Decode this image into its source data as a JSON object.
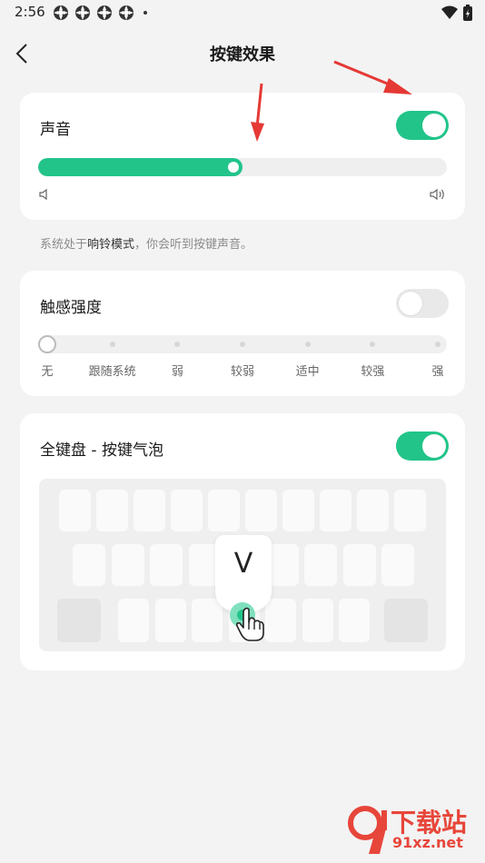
{
  "status": {
    "time": "2:56"
  },
  "header": {
    "title": "按键效果"
  },
  "sound": {
    "label": "声音",
    "enabled": true,
    "volume_percent": 50,
    "hint_prefix": "系统处于",
    "hint_mode": "响铃模式",
    "hint_suffix": "，你会听到按键声音。"
  },
  "haptic": {
    "label": "触感强度",
    "enabled": false,
    "levels": [
      "无",
      "跟随系统",
      "弱",
      "较弱",
      "适中",
      "较强",
      "强"
    ],
    "selected_index": 0
  },
  "keyboard": {
    "label": "全键盘 - 按键气泡",
    "enabled": true,
    "bubble_letter": "V"
  },
  "watermark": {
    "brand": "下载站",
    "domain": "91xz.net"
  },
  "colors": {
    "accent": "#22c48a",
    "background": "#f3f3f3",
    "card": "#ffffff",
    "arrow": "#e53935"
  },
  "icons": {
    "back": "chevron-left-icon",
    "volume_low": "speaker-low-icon",
    "volume_high": "speaker-high-icon",
    "hand": "hand-pointer-icon"
  }
}
